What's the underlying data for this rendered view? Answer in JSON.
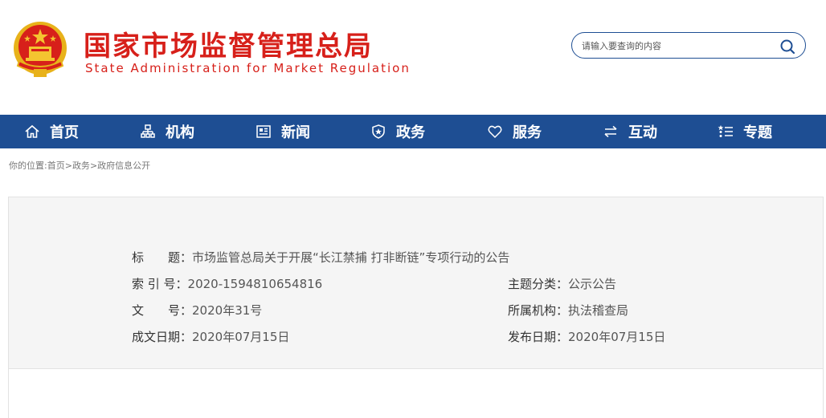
{
  "header": {
    "title_cn": "国家市场监督管理总局",
    "title_en": "State Administration for Market Regulation",
    "search_placeholder": "请输入要查询的内容"
  },
  "nav": {
    "items": [
      {
        "label": "首页",
        "icon": "home-icon"
      },
      {
        "label": "机构",
        "icon": "org-chart-icon"
      },
      {
        "label": "新闻",
        "icon": "newspaper-icon"
      },
      {
        "label": "政务",
        "icon": "shield-icon"
      },
      {
        "label": "服务",
        "icon": "heart-icon"
      },
      {
        "label": "互动",
        "icon": "arrows-exchange-icon"
      },
      {
        "label": "专题",
        "icon": "list-icon"
      }
    ]
  },
  "breadcrumb": {
    "prefix": "你的位置:",
    "items": [
      "首页",
      "政务",
      "政府信息公开"
    ],
    "sep": ">"
  },
  "info": {
    "title_label": "标　　题：",
    "title_value": "市场监管总局关于开展“长江禁捕 打非断链”专项行动的公告",
    "index_label": "索 引 号：",
    "index_value": "2020-1594810654816",
    "topic_label": "主题分类：",
    "topic_value": "公示公告",
    "doc_label": "文　　号：",
    "doc_value": "2020年31号",
    "org_label": "所属机构：",
    "org_value": "执法稽查局",
    "created_label": "成文日期：",
    "created_value": "2020年07月15日",
    "published_label": "发布日期：",
    "published_value": "2020年07月15日"
  },
  "colors": {
    "brand_red": "#d7201a",
    "nav_blue": "#1e4e93"
  }
}
